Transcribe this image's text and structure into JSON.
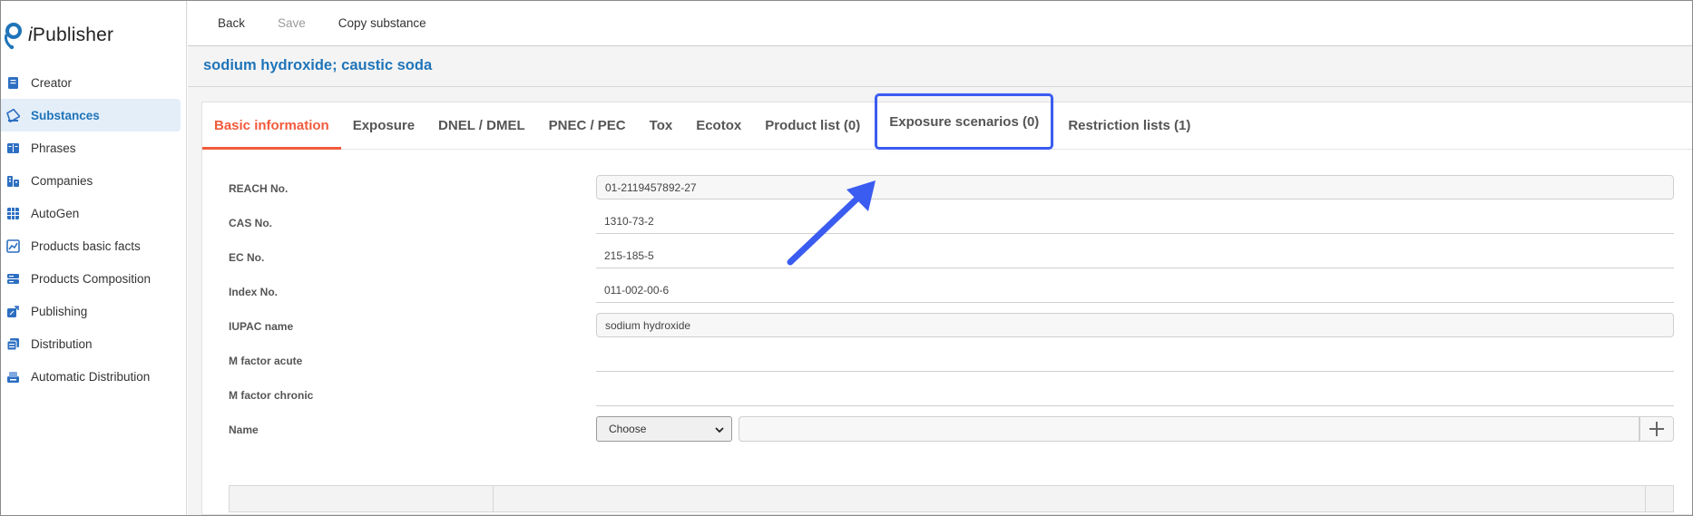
{
  "app": {
    "logo_prefix": "i",
    "logo_name": "Publisher"
  },
  "sidebar": {
    "items": [
      {
        "label": "Creator",
        "icon": "document-icon"
      },
      {
        "label": "Substances",
        "icon": "flask-icon",
        "active": true
      },
      {
        "label": "Phrases",
        "icon": "book-icon"
      },
      {
        "label": "Companies",
        "icon": "building-icon"
      },
      {
        "label": "AutoGen",
        "icon": "grid-icon"
      },
      {
        "label": "Products basic facts",
        "icon": "chart-icon"
      },
      {
        "label": "Products Composition",
        "icon": "layers-icon"
      },
      {
        "label": "Publishing",
        "icon": "share-icon"
      },
      {
        "label": "Distribution",
        "icon": "copy-icon"
      },
      {
        "label": "Automatic Distribution",
        "icon": "tray-icon"
      }
    ]
  },
  "toolbar": {
    "back_label": "Back",
    "save_label": "Save",
    "copy_label": "Copy substance"
  },
  "page": {
    "title": "sodium hydroxide; caustic soda"
  },
  "tabs": [
    {
      "label": "Basic information",
      "active": true
    },
    {
      "label": "Exposure"
    },
    {
      "label": "DNEL / DMEL"
    },
    {
      "label": "PNEC / PEC"
    },
    {
      "label": "Tox"
    },
    {
      "label": "Ecotox"
    },
    {
      "label": "Product list (0)"
    },
    {
      "label": "Exposure scenarios (0)",
      "highlighted": true
    },
    {
      "label": "Restriction lists (1)"
    }
  ],
  "form": {
    "reach_label": "REACH No.",
    "reach_value": "01-2119457892-27",
    "cas_label": "CAS No.",
    "cas_value": "1310-73-2",
    "ec_label": "EC No.",
    "ec_value": "215-185-5",
    "index_label": "Index No.",
    "index_value": "011-002-00-6",
    "iupac_label": "IUPAC name",
    "iupac_value": "sodium hydroxide",
    "m_acute_label": "M factor acute",
    "m_acute_value": "",
    "m_chronic_label": "M factor chronic",
    "m_chronic_value": "",
    "name_label": "Name",
    "name_select": "Choose"
  },
  "colors": {
    "accent_blue": "#1f74b9",
    "active_tab": "#f25a3c",
    "highlight": "#3b5cf0"
  }
}
